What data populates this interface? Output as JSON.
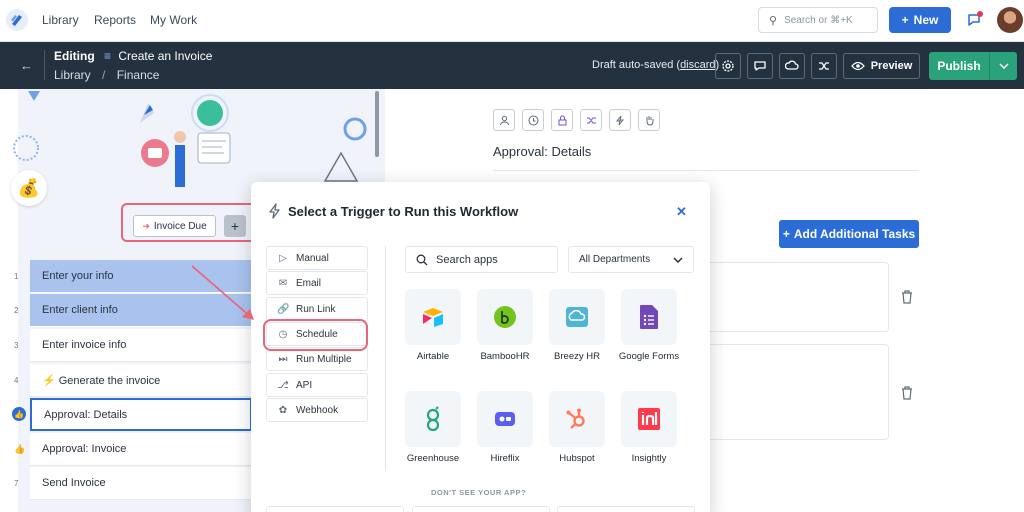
{
  "topnav": {
    "links": [
      "Library",
      "Reports",
      "My Work"
    ],
    "search_placeholder": "Search or ⌘+K",
    "new_label": "New"
  },
  "editbar": {
    "editing_label": "Editing",
    "doc_title": "Create an Invoice",
    "breadcrumb": [
      "Library",
      "Finance"
    ],
    "breadcrumb_sep": "/",
    "autosave_text": "Draft auto-saved",
    "discard_label": "discard",
    "preview_label": "Preview",
    "publish_label": "Publish"
  },
  "left": {
    "trigger_chip_label": "Invoice Due",
    "steps": [
      {
        "num": "1",
        "label": "Enter your info"
      },
      {
        "num": "2",
        "label": "Enter client info"
      },
      {
        "num": "3",
        "label": "Enter invoice info"
      },
      {
        "num": "4",
        "label": "⚡ Generate the invoice"
      },
      {
        "num": "",
        "label": "Approval: Details"
      },
      {
        "num": "",
        "label": "Approval: Invoice"
      },
      {
        "num": "7",
        "label": "Send Invoice"
      }
    ]
  },
  "right": {
    "section_title": "Approval: Details",
    "add_tasks_label": "Add Additional Tasks"
  },
  "modal": {
    "title": "Select a Trigger to Run this Workflow",
    "triggers": [
      "Manual",
      "Email",
      "Run Link",
      "Schedule",
      "Run Multiple",
      "API",
      "Webhook"
    ],
    "search_placeholder": "Search apps",
    "department_selected": "All Departments",
    "apps": [
      {
        "name": "Airtable",
        "icon": "airtable-icon"
      },
      {
        "name": "BambooHR",
        "icon": "bamboohr-icon"
      },
      {
        "name": "Breezy HR",
        "icon": "breezyhr-icon"
      },
      {
        "name": "Google Forms",
        "icon": "google-forms-icon"
      },
      {
        "name": "Greenhouse",
        "icon": "greenhouse-icon"
      },
      {
        "name": "Hireflix",
        "icon": "hireflix-icon"
      },
      {
        "name": "Hubspot",
        "icon": "hubspot-icon"
      },
      {
        "name": "Insightly",
        "icon": "insightly-icon"
      }
    ],
    "dont_see_label": "DON'T SEE YOUR APP?"
  },
  "colors": {
    "primary": "#2b6cd6",
    "publish": "#2aa37a",
    "header_dark": "#243240",
    "highlight_ring": "#e8657a",
    "step_highlight": "#a9c3ee"
  }
}
